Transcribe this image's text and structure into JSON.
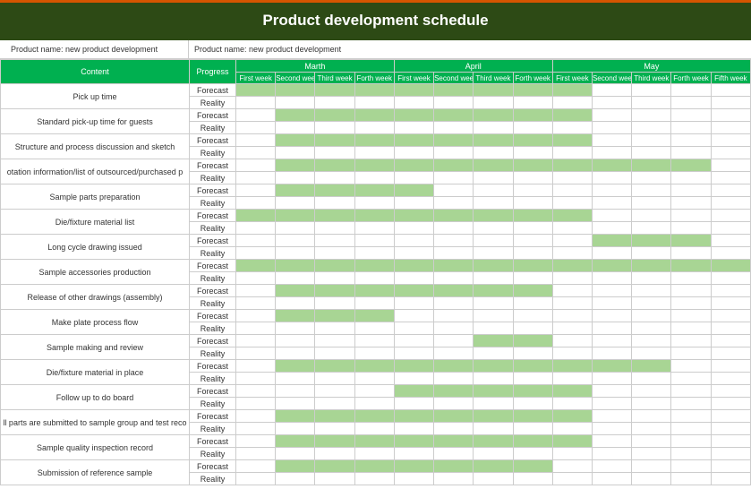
{
  "title": "Product development schedule",
  "info": {
    "left": "Product name: new product development",
    "right": "Product name: new product development"
  },
  "headers": {
    "content": "Content",
    "progress": "Progress",
    "months": [
      "Marth",
      "April",
      "May"
    ],
    "weeks": [
      "First week",
      "Second week",
      "Third week",
      "Forth week",
      "First week",
      "Second week",
      "Third week",
      "Forth week",
      "First week",
      "Second week",
      "Third week",
      "Forth week",
      "Fifth week"
    ]
  },
  "rowLabels": {
    "forecast": "Forecast",
    "reality": "Reality"
  },
  "tasks": [
    {
      "name": "Pick up time",
      "forecast": [
        1,
        1,
        1,
        1,
        1,
        1,
        1,
        1,
        1,
        0,
        0,
        0,
        0
      ]
    },
    {
      "name": "Standard pick-up time for guests",
      "forecast": [
        0,
        1,
        1,
        1,
        1,
        1,
        1,
        1,
        1,
        0,
        0,
        0,
        0
      ]
    },
    {
      "name": "Structure and process discussion and sketch",
      "forecast": [
        0,
        1,
        1,
        1,
        1,
        1,
        1,
        1,
        1,
        0,
        0,
        0,
        0
      ]
    },
    {
      "name": "otation information/list of outsourced/purchased p",
      "forecast": [
        0,
        1,
        1,
        1,
        1,
        1,
        1,
        1,
        1,
        1,
        1,
        1,
        0
      ]
    },
    {
      "name": "Sample parts preparation",
      "forecast": [
        0,
        1,
        1,
        1,
        1,
        0,
        0,
        0,
        0,
        0,
        0,
        0,
        0
      ]
    },
    {
      "name": "Die/fixture material list",
      "forecast": [
        1,
        1,
        1,
        1,
        1,
        1,
        1,
        1,
        1,
        0,
        0,
        0,
        0
      ]
    },
    {
      "name": "Long cycle drawing issued",
      "forecast": [
        0,
        0,
        0,
        0,
        0,
        0,
        0,
        0,
        0,
        1,
        1,
        1,
        0
      ]
    },
    {
      "name": "Sample accessories production",
      "forecast": [
        1,
        1,
        1,
        1,
        1,
        1,
        1,
        1,
        1,
        1,
        1,
        1,
        1
      ]
    },
    {
      "name": "Release of other drawings (assembly)",
      "forecast": [
        0,
        1,
        1,
        1,
        1,
        1,
        1,
        1,
        0,
        0,
        0,
        0,
        0
      ]
    },
    {
      "name": "Make plate process flow",
      "forecast": [
        0,
        1,
        1,
        1,
        0,
        0,
        0,
        0,
        0,
        0,
        0,
        0,
        0
      ]
    },
    {
      "name": "Sample making and review",
      "forecast": [
        0,
        0,
        0,
        0,
        0,
        0,
        1,
        1,
        0,
        0,
        0,
        0,
        0
      ]
    },
    {
      "name": "Die/fixture material in place",
      "forecast": [
        0,
        1,
        1,
        1,
        1,
        1,
        1,
        1,
        1,
        1,
        1,
        0,
        0
      ]
    },
    {
      "name": "Follow up to do board",
      "forecast": [
        0,
        0,
        0,
        0,
        1,
        1,
        1,
        1,
        1,
        0,
        0,
        0,
        0
      ]
    },
    {
      "name": "ll parts are submitted to sample group and test reco",
      "forecast": [
        0,
        1,
        1,
        1,
        1,
        1,
        1,
        1,
        1,
        0,
        0,
        0,
        0
      ]
    },
    {
      "name": "Sample quality inspection record",
      "forecast": [
        0,
        1,
        1,
        1,
        1,
        1,
        1,
        1,
        1,
        0,
        0,
        0,
        0
      ]
    },
    {
      "name": "Submission of reference sample",
      "forecast": [
        0,
        1,
        1,
        1,
        1,
        1,
        1,
        1,
        0,
        0,
        0,
        0,
        0
      ]
    }
  ]
}
